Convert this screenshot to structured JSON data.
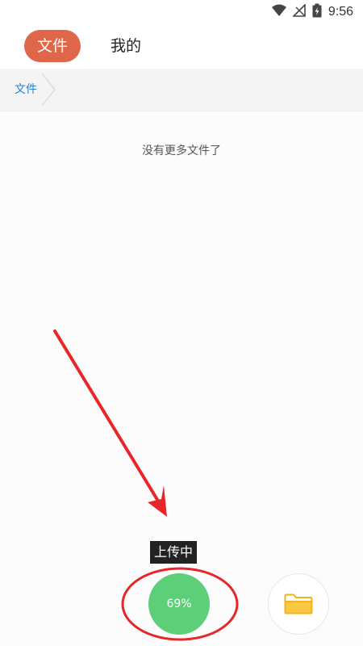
{
  "status_bar": {
    "time": "9:56",
    "icons": [
      "wifi-icon",
      "signal-icon",
      "battery-icon"
    ]
  },
  "tabs": [
    {
      "label": "文件",
      "active": true
    },
    {
      "label": "我的",
      "active": false
    }
  ],
  "breadcrumb": {
    "items": [
      "文件"
    ]
  },
  "main": {
    "empty_message": "没有更多文件了"
  },
  "upload": {
    "tooltip": "上传中",
    "progress_label": "69%",
    "progress": 0.69
  },
  "fab": {
    "folder_icon": "folder-icon"
  },
  "colors": {
    "accent": "#e0664a",
    "upload_green": "#5ecf79",
    "link_blue": "#2a7fd4",
    "annotation_red": "#e8262a",
    "folder_yellow": "#f5b21a"
  }
}
